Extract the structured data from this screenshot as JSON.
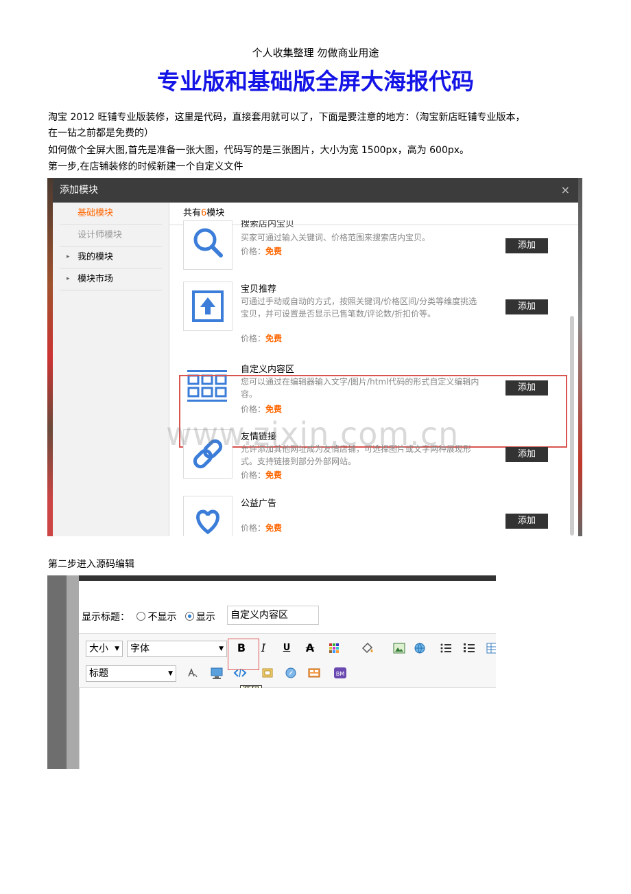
{
  "doc": {
    "header_note": "个人收集整理 勿做商业用途",
    "title": "专业版和基础版全屏大海报代码",
    "p1_line1": "淘宝 2012 旺铺专业版装修，这里是代码，直接套用就可以了，下面是要注意的地方：（淘宝新店旺铺专业版本，",
    "p1_line2": "在一钻之前都是免费的）",
    "p2": "如何做个全屏大图,首先是准备一张大图，代码写的是三张图片，大小为宽 1500px，高为 600px。",
    "step1": "第一步,在店铺装修的时候新建一个自定义文件",
    "step2": "第二步进入源码编辑"
  },
  "dialog": {
    "title": "添加模块",
    "close": "×",
    "sidebar": [
      "基础模块",
      "设计师模块",
      "我的模块",
      "模块市场"
    ],
    "count_prefix": "共有",
    "count_num": "6",
    "count_suffix": "模块",
    "price_label": "价格：",
    "price_value": "免费",
    "add_label": "添加",
    "modules": [
      {
        "name": "搜索店内宝贝",
        "desc": "买家可通过输入关键词、价格范围来搜索店内宝贝。",
        "icon": "search-icon"
      },
      {
        "name": "宝贝推荐",
        "desc": "可通过手动或自动的方式，按照关键词/价格区间/分类等维度挑选宝贝，并可设置是否显示已售笔数/评论数/折扣价等。",
        "icon": "upload-arrow-icon"
      },
      {
        "name": "自定义内容区",
        "desc": "您可以通过在编辑器输入文字/图片/html代码的形式自定义编辑内容。",
        "icon": "grid-layout-icon"
      },
      {
        "name": "友情链接",
        "desc": "允许添加其他网址成为友情店铺，可选择图片或文字两种展现形式。支持链接到部分外部网站。",
        "icon": "link-icon"
      },
      {
        "name": "公益广告",
        "desc": "",
        "icon": "heart-icon"
      }
    ],
    "watermark": "www.zixin.com.cn"
  },
  "editor": {
    "show_title_label": "显示标题：",
    "opt_hide": "不显示",
    "opt_show": "显示",
    "title_value": "自定义内容区",
    "size_select": "大小",
    "font_select": "字体",
    "heading_select": "标题",
    "bold": "B",
    "italic": "I",
    "underline": "U",
    "strike": "A",
    "source_tooltip": "源码"
  }
}
